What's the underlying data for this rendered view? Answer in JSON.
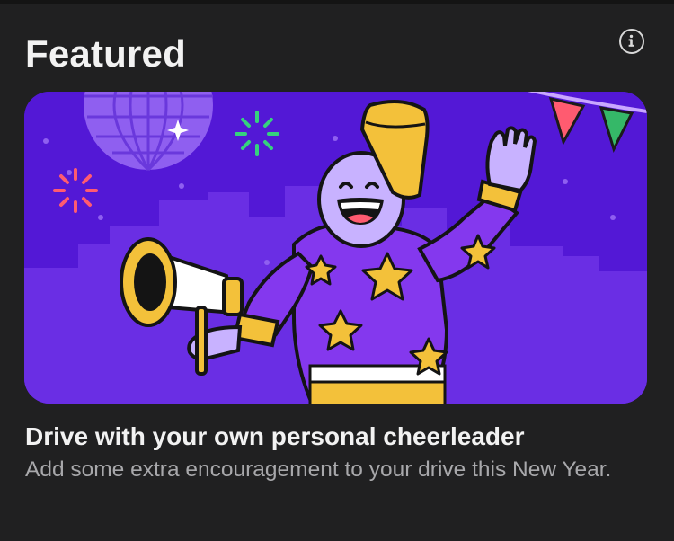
{
  "section": {
    "title": "Featured",
    "info_icon": "info-circle-icon"
  },
  "feature_card": {
    "illustration": "cheerleader-with-megaphone-illustration",
    "headline": "Drive with your own personal cheerleader",
    "description": "Add some extra encouragement to your drive this New Year."
  },
  "colors": {
    "background": "#202021",
    "banner_purple": "#5318d6",
    "accent_yellow": "#f3c13a",
    "text_primary": "#f2f2f2",
    "text_secondary": "#a8a8ab"
  }
}
